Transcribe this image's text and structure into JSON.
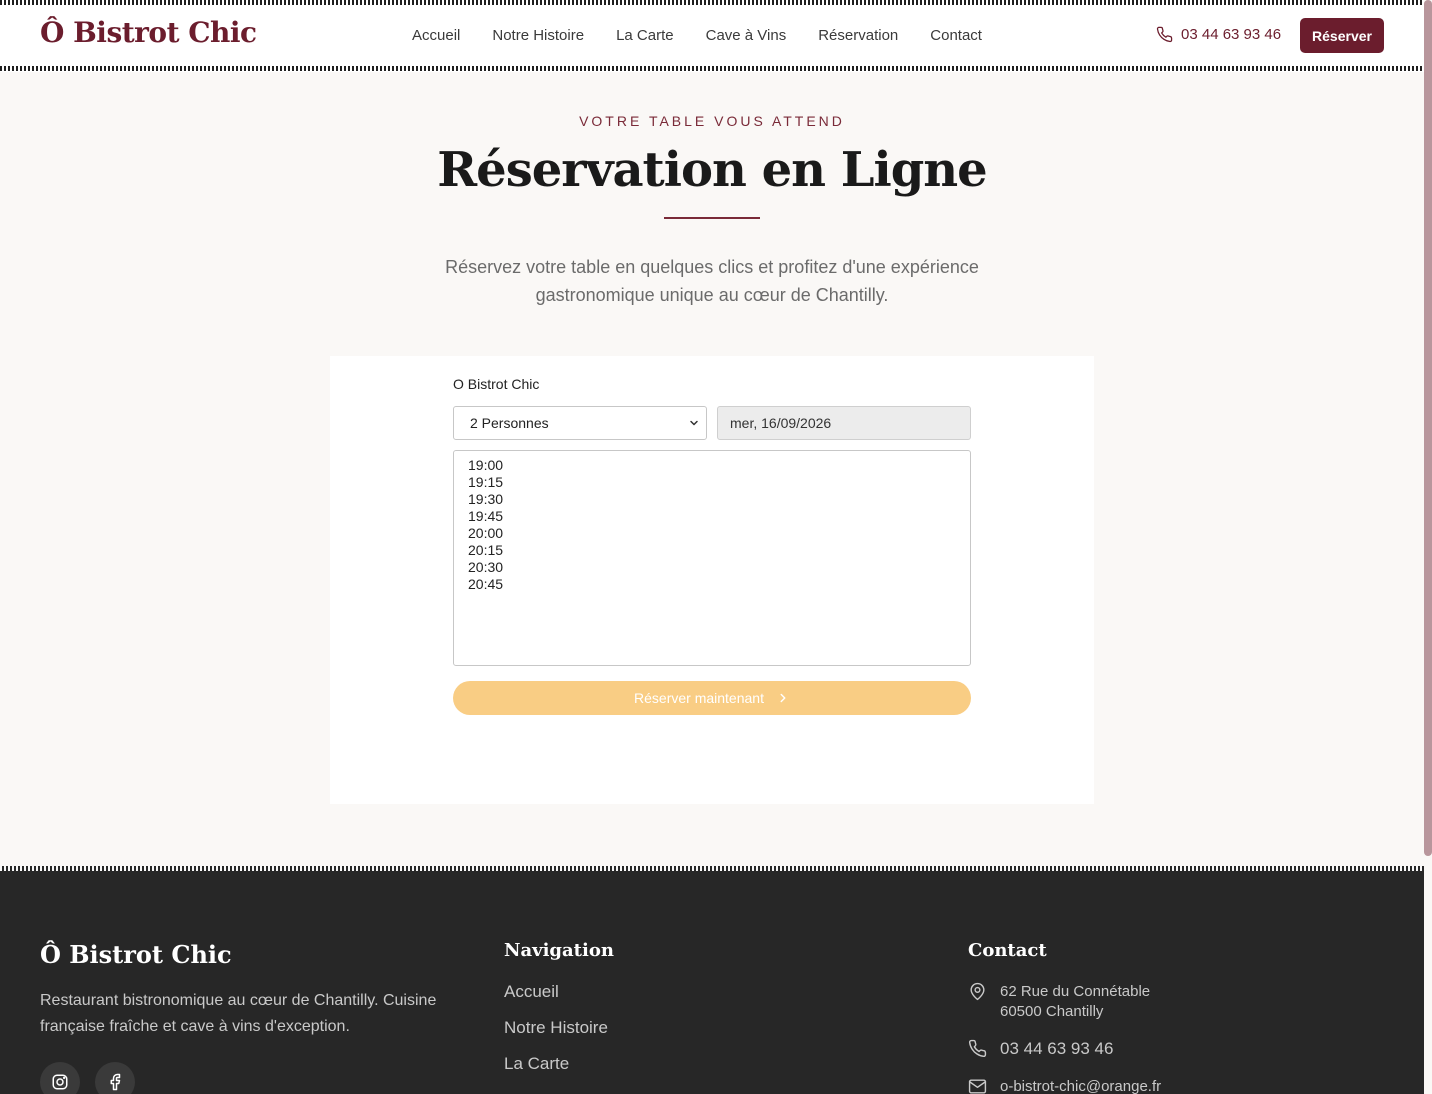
{
  "header": {
    "logo": "Ô Bistrot Chic",
    "nav": [
      "Accueil",
      "Notre Histoire",
      "La Carte",
      "Cave à Vins",
      "Réservation",
      "Contact"
    ],
    "phone": "03 44 63 93 46",
    "reserve_label": "Réserver"
  },
  "hero": {
    "eyebrow": "VOTRE TABLE VOUS ATTEND",
    "title": "Réservation en Ligne",
    "intro": "Réservez votre table en quelques clics et profitez d'une expérience gastronomique unique au cœur de Chantilly."
  },
  "widget": {
    "restaurant_name": "O Bistrot Chic",
    "party_size": "2 Personnes",
    "date": "mer, 16/09/2026",
    "times": [
      "19:00",
      "19:15",
      "19:30",
      "19:45",
      "20:00",
      "20:15",
      "20:30",
      "20:45"
    ],
    "book_label": "Réserver maintenant"
  },
  "footer": {
    "logo": "Ô Bistrot Chic",
    "description": "Restaurant bistronomique au cœur de Chantilly. Cuisine française fraîche et cave à vins d'exception.",
    "nav_heading": "Navigation",
    "nav": [
      "Accueil",
      "Notre Histoire",
      "La Carte"
    ],
    "contact_heading": "Contact",
    "address_line1": "62 Rue du Connétable",
    "address_line2": "60500 Chantilly",
    "phone": "03 44 63 93 46",
    "email": "o-bistrot-chic@orange.fr"
  },
  "colors": {
    "brand": "#6b1d2d",
    "button_disabled": "#f9cd84",
    "footer_bg": "#272727"
  }
}
